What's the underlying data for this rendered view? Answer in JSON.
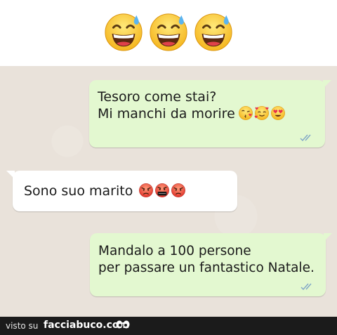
{
  "header": {
    "emojis": [
      "grinning-sweat-emoji",
      "grinning-sweat-emoji",
      "grinning-sweat-emoji"
    ]
  },
  "messages": [
    {
      "direction": "outgoing",
      "lines": [
        "Tesoro come stai?",
        "Mi manchi da morire"
      ],
      "emojis": [
        "kissing-heart-emoji",
        "smiling-hearts-emoji",
        "heart-eyes-emoji"
      ],
      "status": "read-double-check"
    },
    {
      "direction": "incoming",
      "lines": [
        "Sono suo marito"
      ],
      "emojis": [
        "angry-face-emoji",
        "cursing-face-emoji",
        "angry-face-emoji"
      ]
    },
    {
      "direction": "outgoing",
      "lines": [
        "Mandalo a 100 persone",
        "per passare un fantastico Natale."
      ],
      "status": "read-double-check"
    }
  ],
  "footer": {
    "visto_label": "visto su",
    "site": "facciabuco.com"
  },
  "colors": {
    "outgoing_bubble": "#e3f8d0",
    "incoming_bubble": "#ffffff",
    "chat_background": "#e9e2da",
    "read_ticks": "#7fa5c7",
    "footer_background": "#1b1b1b"
  }
}
